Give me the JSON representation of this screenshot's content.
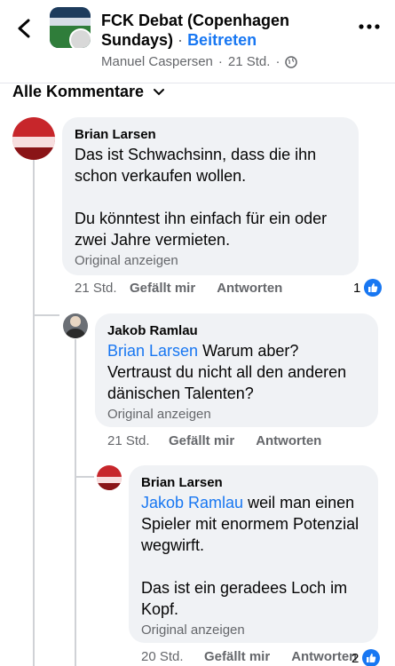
{
  "header": {
    "group_name": "FCK Debat (Copenhagen Sundays)",
    "dot": "·",
    "join_label": "Beitreten",
    "author": "Manuel Caspersen",
    "separator": "·",
    "time": "21 Std.",
    "globe_sep": "·"
  },
  "filter": {
    "label": "Alle Kommentare"
  },
  "comments": [
    {
      "author": "Brian Larsen",
      "paragraphs": [
        "Das ist Schwachsinn, dass die ihn schon verkaufen wollen.",
        "Du könntest ihn einfach für ein oder zwei Jahre vermieten."
      ],
      "original_label": "Original anzeigen",
      "time": "21 Std.",
      "like_label": "Gefällt mir",
      "reply_label": "Antworten",
      "like_count": "1"
    },
    {
      "author": "Jakob Ramlau",
      "mention": "Brian Larsen",
      "text": " Warum aber? Vertraust du nicht all den anderen dänischen Talenten?",
      "original_label": "Original anzeigen",
      "time": "21 Std.",
      "like_label": "Gefällt mir",
      "reply_label": "Antworten"
    },
    {
      "author": "Brian Larsen",
      "mention": "Jakob Ramlau",
      "text": " weil man einen Spieler mit enormem Potenzial wegwirft.",
      "paragraph2": "Das ist ein geradees Loch im Kopf.",
      "original_label": "Original anzeigen",
      "time": "20 Std.",
      "like_label": "Gefällt mir",
      "reply_label": "Antworten",
      "like_count": "2"
    }
  ],
  "colors": {
    "accent": "#1877f2",
    "bubble": "#f0f2f5",
    "muted": "#65676b"
  }
}
